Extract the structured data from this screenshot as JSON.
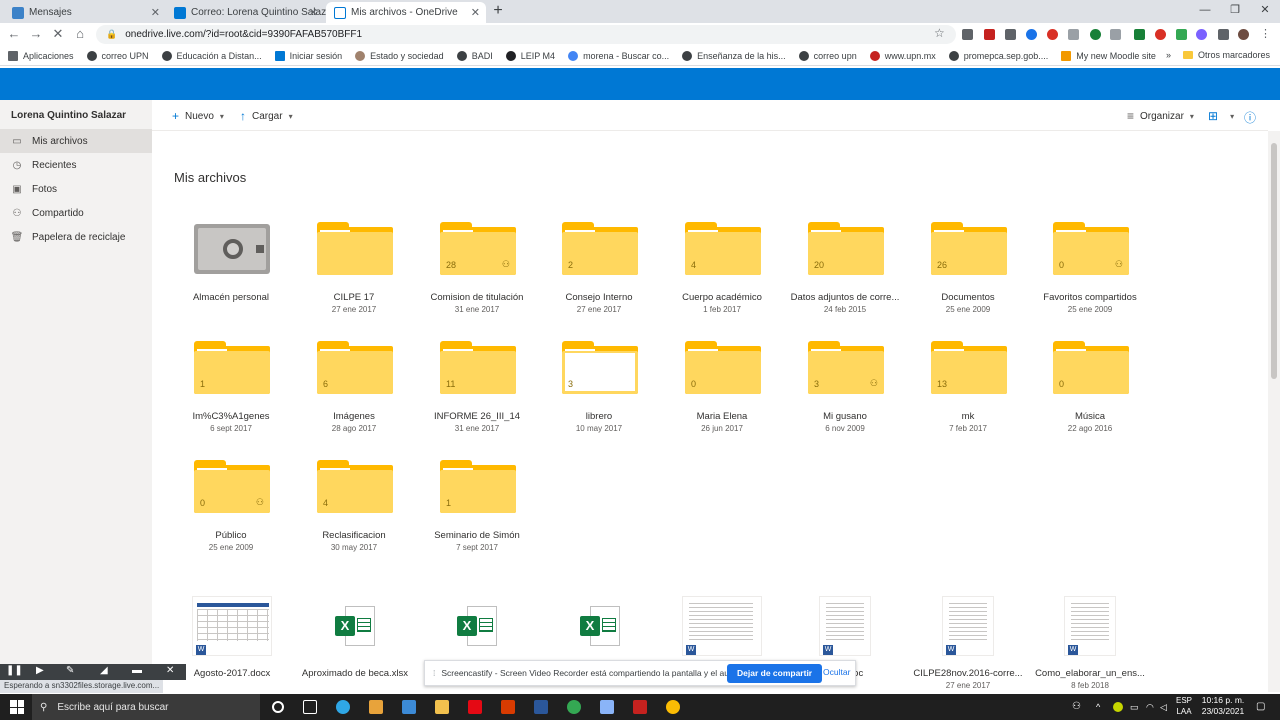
{
  "browser": {
    "tabs": [
      {
        "label": "Mensajes",
        "favicon_color": "#3c82c8"
      },
      {
        "label": "Correo: Lorena Quintino Salazar",
        "favicon_color": "#0078d4"
      },
      {
        "label": "Mis archivos - OneDrive",
        "favicon_color": "#0078d4"
      }
    ],
    "new_tab": "+",
    "url": "onedrive.live.com/?id=root&cid=9390FAFAB570BFF1",
    "window_controls": {
      "minimize": "—",
      "restore": "❐",
      "close": "✕"
    }
  },
  "bookmarks": [
    {
      "label": "Aplicaciones",
      "color": "#5f6368"
    },
    {
      "label": "correo UPN",
      "color": "#3c4043"
    },
    {
      "label": "Educación a Distan...",
      "color": "#3c4043"
    },
    {
      "label": "Iniciar sesión",
      "color": "#0078d4"
    },
    {
      "label": "Estado y sociedad",
      "color": "#a0826d"
    },
    {
      "label": "BADI",
      "color": "#3c4043"
    },
    {
      "label": "LEIP M4",
      "color": "#202124"
    },
    {
      "label": "morena - Buscar co...",
      "color": "#4285f4"
    },
    {
      "label": "Enseñanza de la his...",
      "color": "#3c4043"
    },
    {
      "label": "correo upn",
      "color": "#3c4043"
    },
    {
      "label": "www.upn.mx",
      "color": "#c5221f"
    },
    {
      "label": "promepca.sep.gob....",
      "color": "#3c4043"
    },
    {
      "label": "My new Moodle site",
      "color": "#f29900"
    }
  ],
  "bookmarks_more": "»",
  "bookmarks_other": "Otros marcadores",
  "sidebar": {
    "user": "Lorena Quintino Salazar",
    "items": [
      {
        "label": "Mis archivos",
        "icon": "folder-icon"
      },
      {
        "label": "Recientes",
        "icon": "clock-icon"
      },
      {
        "label": "Fotos",
        "icon": "photo-icon"
      },
      {
        "label": "Compartido",
        "icon": "people-icon"
      },
      {
        "label": "Papelera de reciclaje",
        "icon": "trash-icon"
      }
    ]
  },
  "commands": {
    "new": "Nuevo",
    "upload": "Cargar",
    "sort": "Organizar"
  },
  "page_title": "Mis archivos",
  "tiles": [
    {
      "name": "Almacén personal",
      "date": "",
      "count": "",
      "shared": false,
      "type": "vault"
    },
    {
      "name": "CILPE 17",
      "date": "27 ene 2017",
      "count": "",
      "shared": false,
      "type": "folder"
    },
    {
      "name": "Comision de titulación",
      "date": "31 ene 2017",
      "count": "28",
      "shared": true,
      "type": "folder"
    },
    {
      "name": "Consejo Interno",
      "date": "27 ene 2017",
      "count": "2",
      "shared": false,
      "type": "folder"
    },
    {
      "name": "Cuerpo académico",
      "date": "1 feb 2017",
      "count": "4",
      "shared": false,
      "type": "folder"
    },
    {
      "name": "Datos adjuntos de corre...",
      "date": "24 feb 2015",
      "count": "20",
      "shared": false,
      "type": "folder"
    },
    {
      "name": "Documentos",
      "date": "25 ene 2009",
      "count": "26",
      "shared": false,
      "type": "folder"
    },
    {
      "name": "Favoritos compartidos",
      "date": "25 ene 2009",
      "count": "0",
      "shared": true,
      "type": "folder"
    },
    {
      "name": "Im%C3%A1genes",
      "date": "6 sept 2017",
      "count": "1",
      "shared": false,
      "type": "folder"
    },
    {
      "name": "Imágenes",
      "date": "28 ago 2017",
      "count": "6",
      "shared": false,
      "type": "folder"
    },
    {
      "name": "INFORME 26_III_14",
      "date": "31 ene 2017",
      "count": "11",
      "shared": false,
      "type": "folder"
    },
    {
      "name": "librero",
      "date": "10 may 2017",
      "count": "3",
      "shared": false,
      "type": "folder-open"
    },
    {
      "name": "Maria Elena",
      "date": "26 jun 2017",
      "count": "0",
      "shared": false,
      "type": "folder"
    },
    {
      "name": "Mi gusano",
      "date": "6 nov 2009",
      "count": "3",
      "shared": true,
      "type": "folder"
    },
    {
      "name": "mk",
      "date": "7 feb 2017",
      "count": "13",
      "shared": false,
      "type": "folder"
    },
    {
      "name": "Música",
      "date": "22 ago 2016",
      "count": "0",
      "shared": false,
      "type": "folder"
    },
    {
      "name": "Público",
      "date": "25 ene 2009",
      "count": "0",
      "shared": true,
      "type": "folder"
    },
    {
      "name": "Reclasificacion",
      "date": "30 may 2017",
      "count": "4",
      "shared": false,
      "type": "folder"
    },
    {
      "name": "Seminario de Simón",
      "date": "7 sept 2017",
      "count": "1",
      "shared": false,
      "type": "folder"
    }
  ],
  "files": [
    {
      "name": "Agosto-2017.docx",
      "date": "",
      "type": "word-calendar"
    },
    {
      "name": "Aproximado de beca.xlsx",
      "date": "",
      "type": "excel"
    },
    {
      "name": "",
      "date": "",
      "type": "excel"
    },
    {
      "name": "",
      "date": "",
      "type": "excel"
    },
    {
      "name": "",
      "date": "",
      "type": "word-table"
    },
    {
      "name": "...17.doc",
      "date": "",
      "type": "word-doc"
    },
    {
      "name": "CILPE28nov.2016-corre...",
      "date": "27 ene 2017",
      "type": "word-doc"
    },
    {
      "name": "Como_elaborar_un_ens...",
      "date": "8 feb 2018",
      "type": "word-doc"
    }
  ],
  "screencastify": {
    "message": "Screencastify - Screen Video Recorder está compartiendo la pantalla y el audio.",
    "stop": "Dejar de compartir",
    "hide": "Ocultar"
  },
  "status": "Esperando a sn3302files.storage.live.com...",
  "taskbar": {
    "search": "Escribe aquí para buscar",
    "lang_top": "ESP",
    "lang_bottom": "LAA",
    "time": "10:16 p. m.",
    "date": "23/03/2021"
  }
}
